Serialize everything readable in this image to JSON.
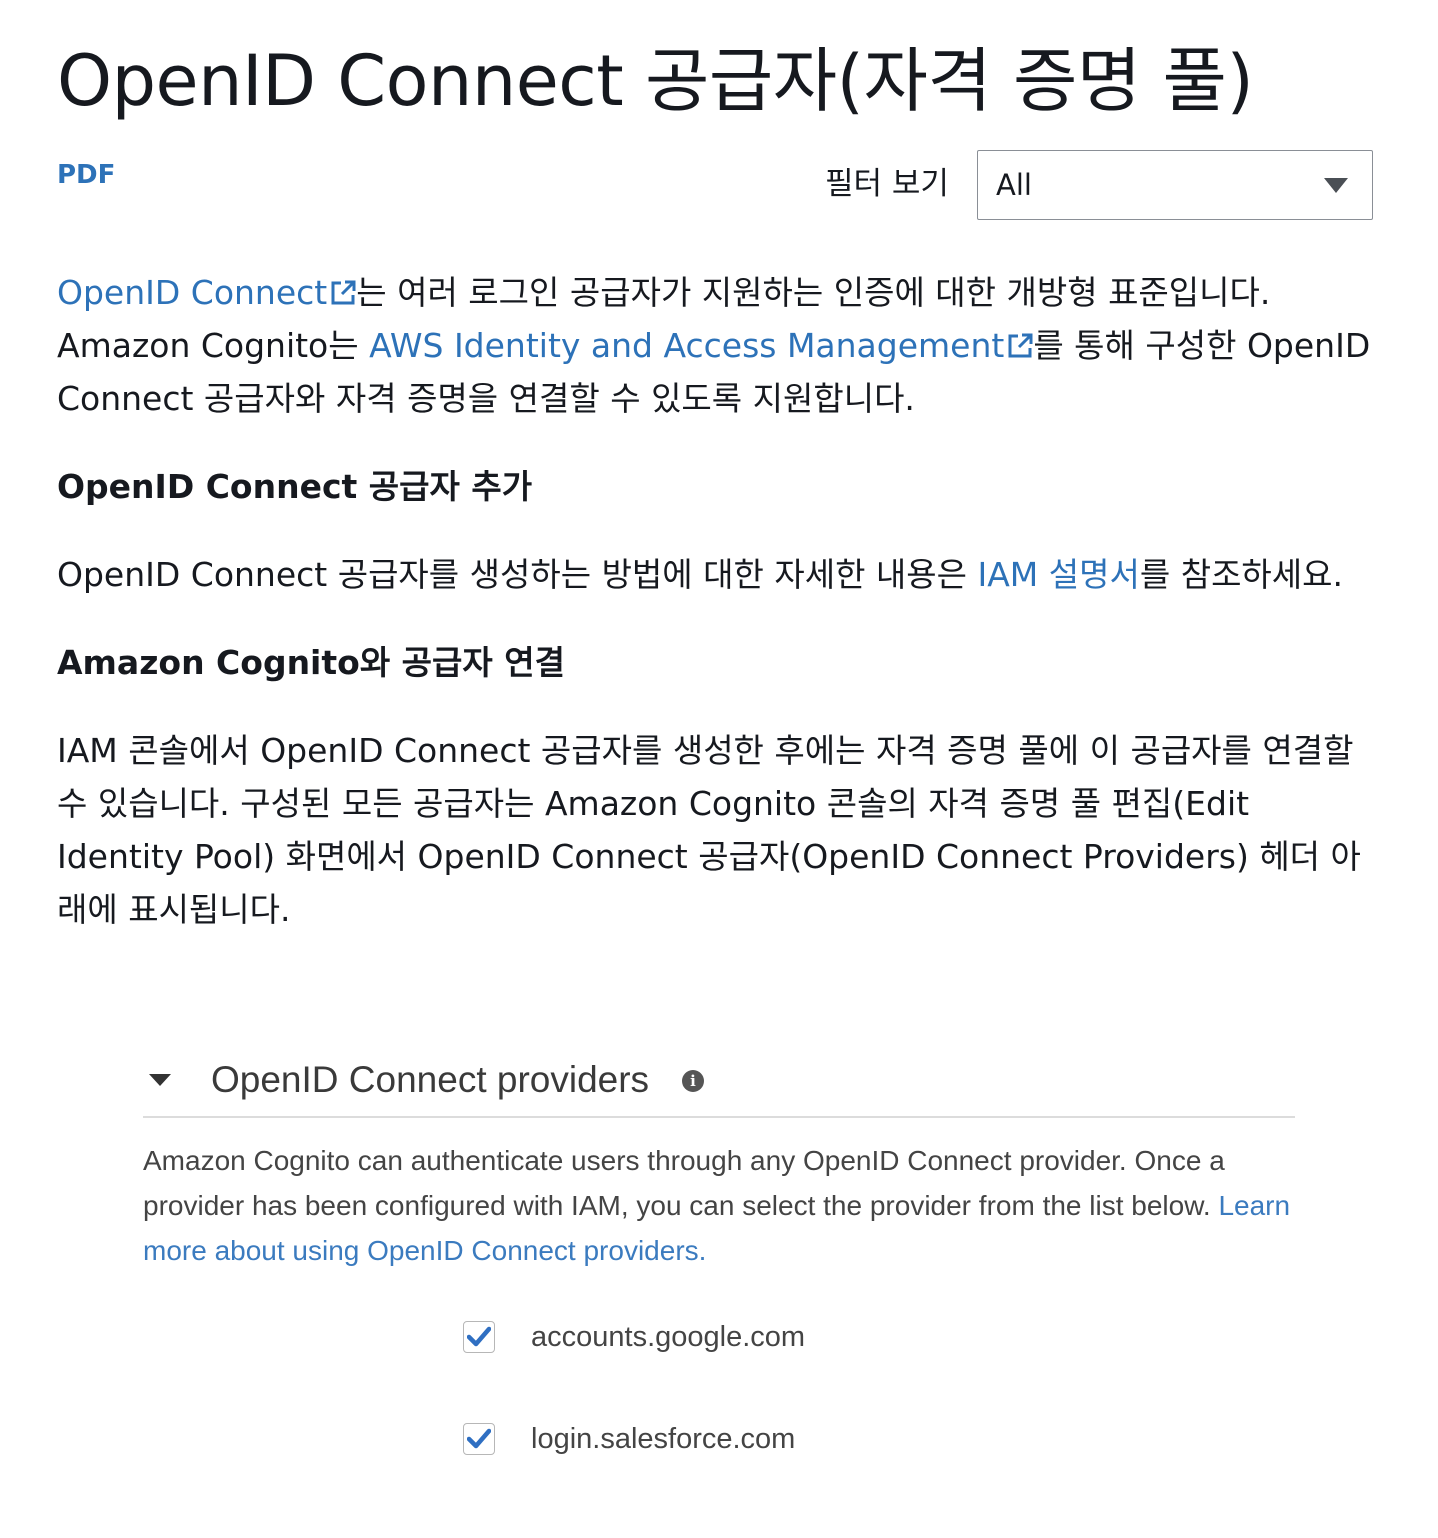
{
  "page": {
    "title": "OpenID Connect 공급자(자격 증명 풀)",
    "pdf_link": "PDF",
    "filter": {
      "label": "필터 보기",
      "selected": "All"
    }
  },
  "intro": {
    "link1": "OpenID Connect",
    "text1": "는 여러 로그인 공급자가 지원하는 인증에 대한 개방형 표준입니다. Amazon Cognito는 ",
    "link2": "AWS Identity and Access Management",
    "text2": "를 통해 구성한 OpenID Connect 공급자와 자격 증명을 연결할 수 있도록 지원합니다."
  },
  "section_add": {
    "heading": "OpenID Connect 공급자 추가",
    "text_before": "OpenID Connect 공급자를 생성하는 방법에 대한 자세한 내용은 ",
    "link": "IAM 설명서",
    "text_after": "를 참조하세요."
  },
  "section_associate": {
    "heading": "Amazon Cognito와 공급자 연결",
    "text": "IAM 콘솔에서 OpenID Connect 공급자를 생성한 후에는 자격 증명 풀에 이 공급자를 연결할 수 있습니다. 구성된 모든 공급자는 Amazon Cognito 콘솔의 자격 증명 풀 편집(Edit Identity Pool) 화면에서 OpenID Connect 공급자(OpenID Connect Providers) 헤더 아래에 표시됩니다."
  },
  "panel": {
    "title": "OpenID Connect providers",
    "info_icon": "i",
    "description": "Amazon Cognito can authenticate users through any OpenID Connect provider. Once a provider has been configured with IAM, you can select the provider from the list below. ",
    "learn_more": "Learn more about using OpenID Connect providers.",
    "providers": [
      {
        "label": "accounts.google.com",
        "checked": true
      },
      {
        "label": "login.salesforce.com",
        "checked": true
      }
    ]
  },
  "colors": {
    "link": "#2d72b8",
    "text": "#16191f",
    "checkmark": "#2f6fc2"
  },
  "icons": [
    "external-link-icon",
    "caret-down-icon",
    "info-icon",
    "checkmark-icon"
  ]
}
